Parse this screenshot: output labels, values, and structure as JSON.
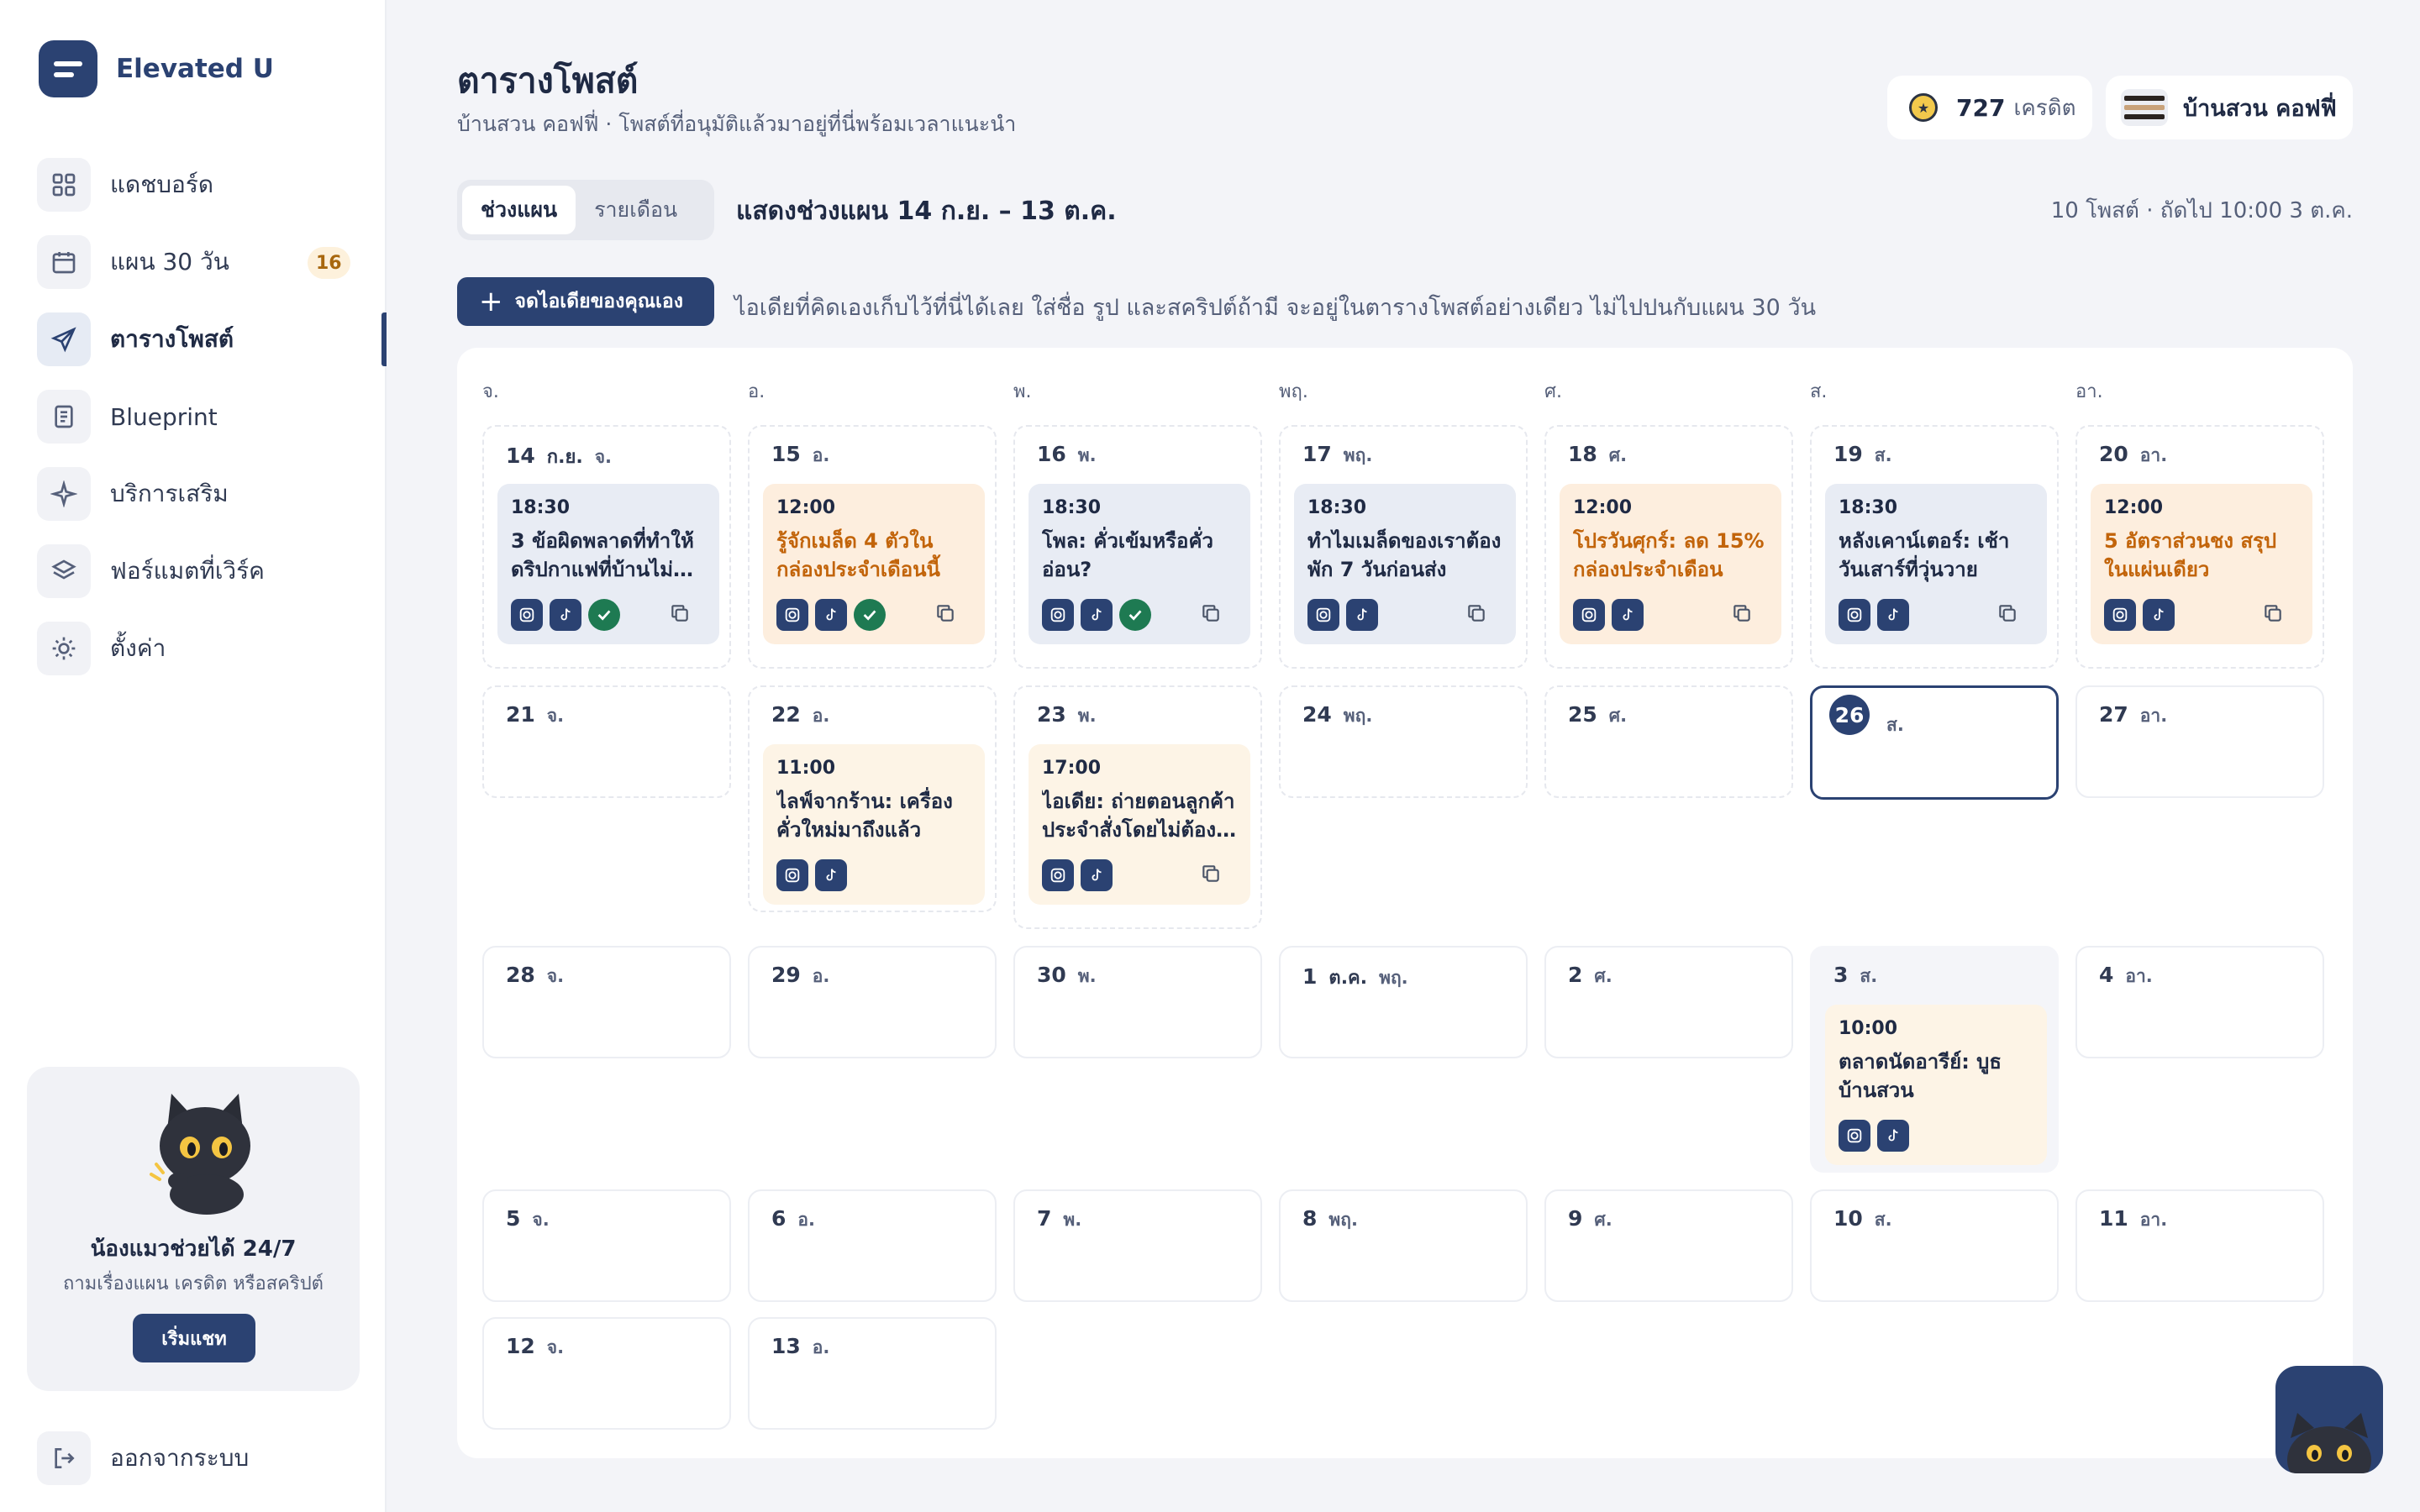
{
  "app": {
    "name": "Elevated U"
  },
  "nav": [
    {
      "label": "แดชบอร์ด",
      "icon": "grid-icon"
    },
    {
      "label": "แผน 30 วัน",
      "icon": "calendar-icon",
      "badge": "16"
    },
    {
      "label": "ตารางโพสต์",
      "icon": "send-icon",
      "active": true
    },
    {
      "label": "Blueprint",
      "icon": "document-icon"
    },
    {
      "label": "บริการเสริม",
      "icon": "sparkle-icon"
    },
    {
      "label": "ฟอร์แมตที่เวิร์ค",
      "icon": "layers-icon"
    },
    {
      "label": "ตั้งค่า",
      "icon": "sun-gear-icon"
    }
  ],
  "help": {
    "title": "น้องแมวช่วยได้ 24/7",
    "subtitle": "ถามเรื่องแผน เครดิต หรือสคริปต์",
    "button": "เริ่มแชท"
  },
  "logout": {
    "label": "ออกจากระบบ"
  },
  "header": {
    "title": "ตารางโพสต์",
    "subtitle": "บ้านสวน คอฟฟี่ · โพสต์ที่อนุมัติแล้วมาอยู่ที่นี่พร้อมเวลาแนะนำ",
    "credits": "727",
    "credits_unit": "เครดิต",
    "shop": "บ้านสวน คอฟฟี่"
  },
  "toolbar": {
    "tab_range": "ช่วงแผน",
    "tab_month": "รายเดือน",
    "range_label": "แสดงช่วงแผน 14 ก.ย. – 13 ต.ค.",
    "summary": "10 โพสต์ · ถัดไป 10:00 3 ต.ค.",
    "add_button": "จดไอเดียของคุณเอง",
    "hint": "ไอเดียที่คิดเองเก็บไว้ที่นี่ได้เลย ใส่ชื่อ รูป และสคริปต์ถ้ามี จะอยู่ในตารางโพสต์อย่างเดียว ไม่ไปปนกับแผน 30 วัน"
  },
  "calendar": {
    "weekdays": [
      "จ.",
      "อ.",
      "พ.",
      "พฤ.",
      "ศ.",
      "ส.",
      "อา."
    ],
    "days": [
      {
        "num": "14",
        "month": "ก.ย.",
        "wd": "จ.",
        "style": "dash",
        "post": {
          "time": "18:30",
          "title": "3 ข้อผิดพลาดที่ทำให้ดริปกาแฟที่บ้านไม่…",
          "color": "gray",
          "approved": true,
          "copy": true
        }
      },
      {
        "num": "15",
        "wd": "อ.",
        "style": "dash",
        "post": {
          "time": "12:00",
          "title": "รู้จักเมล็ด 4 ตัวในกล่องประจำเดือนนี้",
          "color": "peach",
          "approved": true,
          "copy": true
        }
      },
      {
        "num": "16",
        "wd": "พ.",
        "style": "dash",
        "post": {
          "time": "18:30",
          "title": "โพล: คั่วเข้มหรือคั่วอ่อน?",
          "color": "gray",
          "approved": true,
          "copy": true
        }
      },
      {
        "num": "17",
        "wd": "พฤ.",
        "style": "dash",
        "post": {
          "time": "18:30",
          "title": "ทำไมเมล็ดของเราต้องพัก 7 วันก่อนส่ง",
          "color": "gray",
          "approved": false,
          "copy": true
        }
      },
      {
        "num": "18",
        "wd": "ศ.",
        "style": "dash",
        "post": {
          "time": "12:00",
          "title": "โปรวันศุกร์: ลด 15% กล่องประจำเดือน",
          "color": "peach",
          "approved": false,
          "copy": true
        }
      },
      {
        "num": "19",
        "wd": "ส.",
        "style": "dash",
        "post": {
          "time": "18:30",
          "title": "หลังเคาน์เตอร์: เช้าวันเสาร์ที่วุ่นวาย",
          "color": "gray",
          "approved": false,
          "copy": true
        }
      },
      {
        "num": "20",
        "wd": "อา.",
        "style": "dash",
        "post": {
          "time": "12:00",
          "title": "5 อัตราส่วนชง สรุปในแผ่นเดียว",
          "color": "peach",
          "approved": false,
          "copy": true
        }
      },
      {
        "num": "21",
        "wd": "จ.",
        "style": "dash"
      },
      {
        "num": "22",
        "wd": "อ.",
        "style": "dash",
        "post": {
          "time": "11:00",
          "title": "ไลฟ์จากร้าน: เครื่องคั่วใหม่มาถึงแล้ว",
          "color": "cream",
          "approved": false,
          "copy": false
        }
      },
      {
        "num": "23",
        "wd": "พ.",
        "style": "dash",
        "post": {
          "time": "17:00",
          "title": "ไอเดีย: ถ่ายตอนลูกค้าประจำสั่งโดยไม่ต้อง…",
          "color": "cream",
          "approved": false,
          "copy": true
        }
      },
      {
        "num": "24",
        "wd": "พฤ.",
        "style": "dash"
      },
      {
        "num": "25",
        "wd": "ศ.",
        "style": "dash"
      },
      {
        "num": "26",
        "wd": "ส.",
        "style": "today"
      },
      {
        "num": "27",
        "wd": "อา.",
        "style": "solid"
      },
      {
        "num": "28",
        "wd": "จ.",
        "style": "solid"
      },
      {
        "num": "29",
        "wd": "อ.",
        "style": "solid"
      },
      {
        "num": "30",
        "wd": "พ.",
        "style": "solid"
      },
      {
        "num": "1",
        "month": "ต.ค.",
        "wd": "พฤ.",
        "style": "solid"
      },
      {
        "num": "2",
        "wd": "ศ.",
        "style": "solid"
      },
      {
        "num": "3",
        "wd": "ส.",
        "style": "shade",
        "post": {
          "time": "10:00",
          "title": "ตลาดนัดอารีย์: บูธบ้านสวน",
          "color": "cream",
          "approved": false,
          "copy": false
        }
      },
      {
        "num": "4",
        "wd": "อา.",
        "style": "solid"
      },
      {
        "num": "5",
        "wd": "จ.",
        "style": "solid"
      },
      {
        "num": "6",
        "wd": "อ.",
        "style": "solid"
      },
      {
        "num": "7",
        "wd": "พ.",
        "style": "solid"
      },
      {
        "num": "8",
        "wd": "พฤ.",
        "style": "solid"
      },
      {
        "num": "9",
        "wd": "ศ.",
        "style": "solid"
      },
      {
        "num": "10",
        "wd": "ส.",
        "style": "solid"
      },
      {
        "num": "11",
        "wd": "อา.",
        "style": "solid"
      },
      {
        "num": "12",
        "wd": "จ.",
        "style": "solid"
      },
      {
        "num": "13",
        "wd": "อ.",
        "style": "solid"
      }
    ]
  }
}
